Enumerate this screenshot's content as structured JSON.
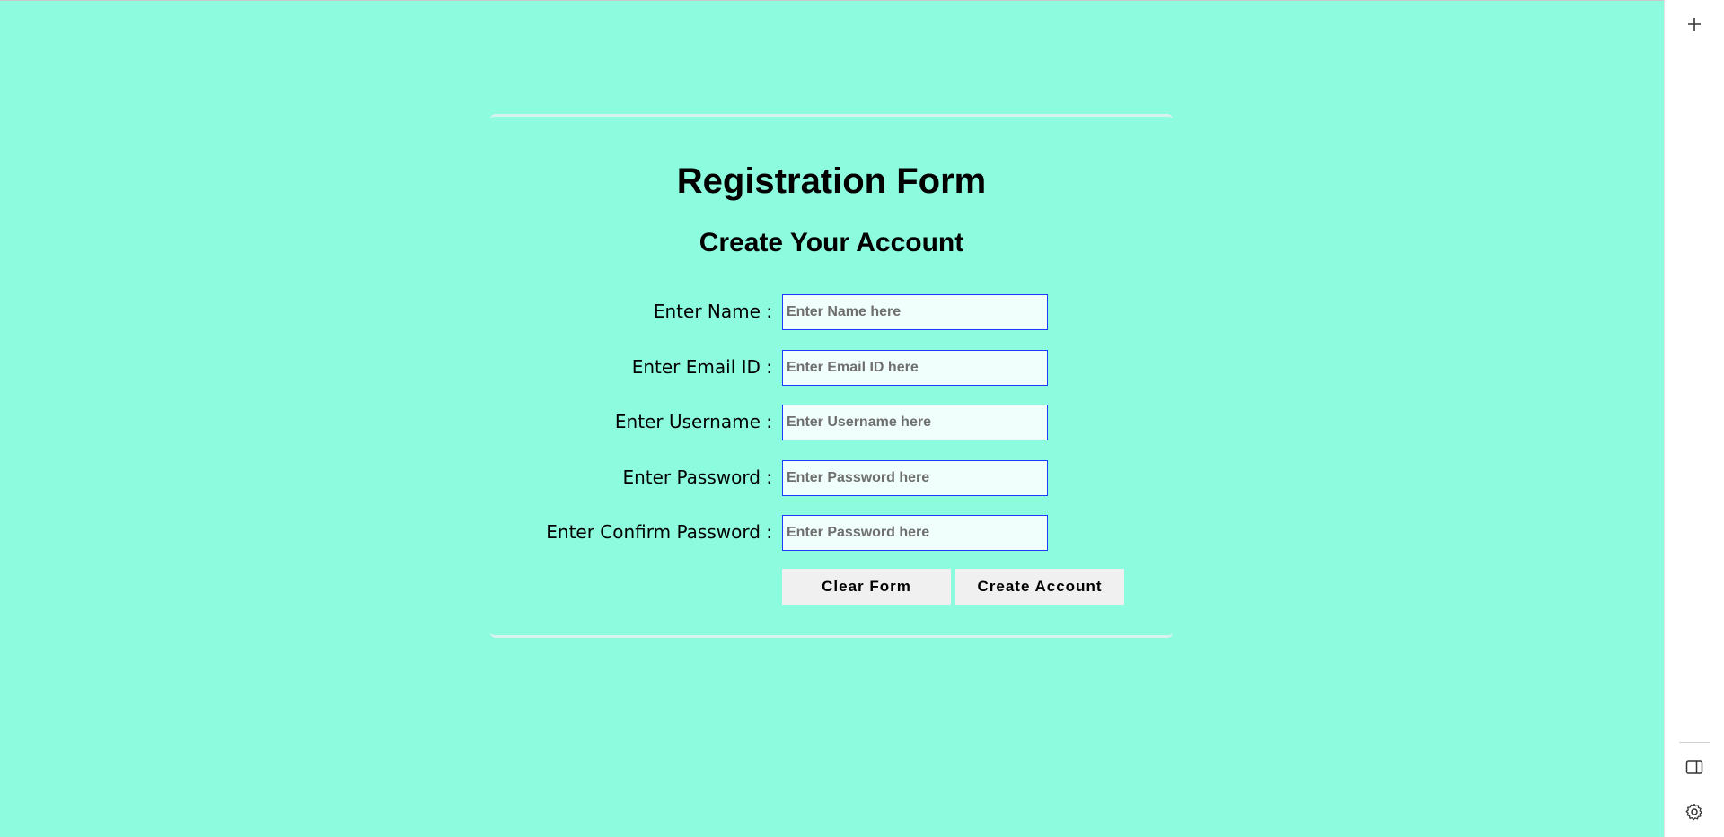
{
  "form": {
    "title": "Registration Form",
    "subtitle": "Create Your Account",
    "fields": [
      {
        "label": "Enter Name :",
        "placeholder": "Enter Name here",
        "value": ""
      },
      {
        "label": "Enter Email ID :",
        "placeholder": "Enter Email ID here",
        "value": ""
      },
      {
        "label": "Enter Username :",
        "placeholder": "Enter Username here",
        "value": ""
      },
      {
        "label": "Enter Password :",
        "placeholder": "Enter Password here",
        "value": ""
      },
      {
        "label": "Enter Confirm Password :",
        "placeholder": "Enter Password here",
        "value": ""
      }
    ],
    "clear_button": "Clear Form",
    "create_button": "Create Account"
  },
  "side_panel": {
    "icons": [
      "plus-icon",
      "sidebar-toggle-icon",
      "gear-icon"
    ]
  },
  "colors": {
    "page_background": "#8cfbde",
    "input_border": "#1f3bff",
    "input_background": "#f0fffb",
    "button_background": "#f0f0f0"
  }
}
